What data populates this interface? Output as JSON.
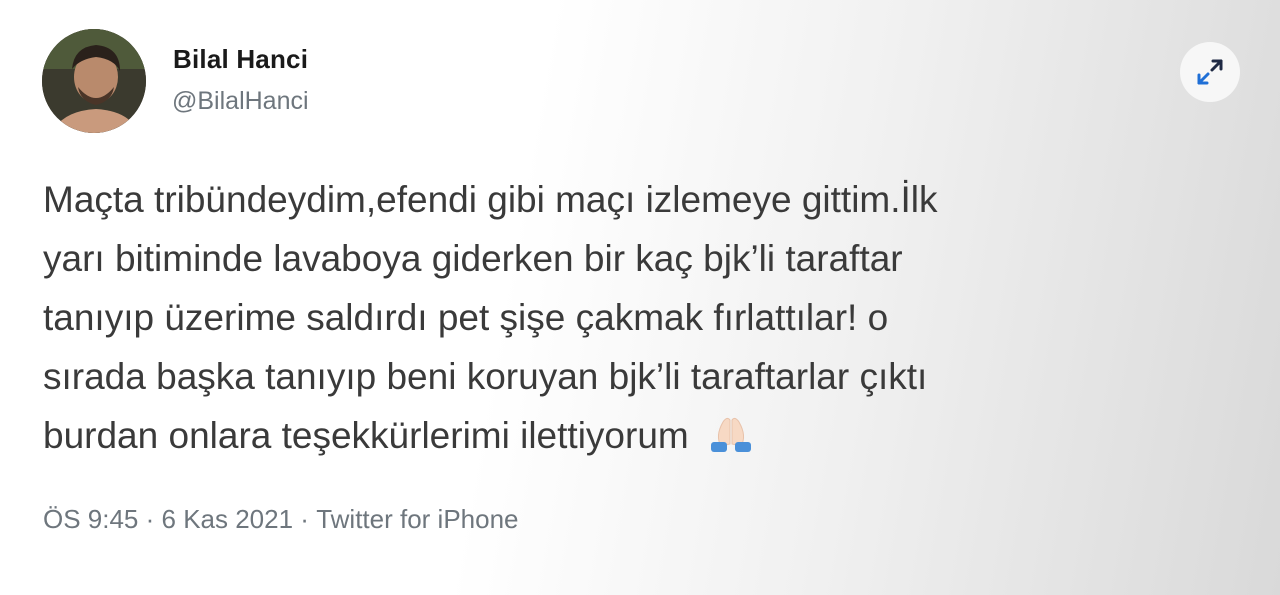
{
  "user": {
    "name": "Bilal Hanci",
    "handle": "@BilalHanci"
  },
  "tweet": {
    "text": "Maçta tribündeydim,efendi gibi maçı izlemeye gittim.İlk\nyarı bitiminde lavaboya giderken bir kaç bjk’li taraftar\ntanıyıp üzerime saldırdı pet şişe çakmak fırlattılar! o\nsırada başka tanıyıp beni koruyan bjk’li taraftarlar çıktı\nburdan onlara teşekkürlerimi ilettiyorum",
    "emoji_icon": "folded-hands-icon"
  },
  "meta": {
    "time": "ÖS 9:45",
    "separator": " · ",
    "date": "6 Kas 2021",
    "source": "Twitter for iPhone"
  },
  "icons": {
    "expand": "expand-arrows-icon"
  }
}
